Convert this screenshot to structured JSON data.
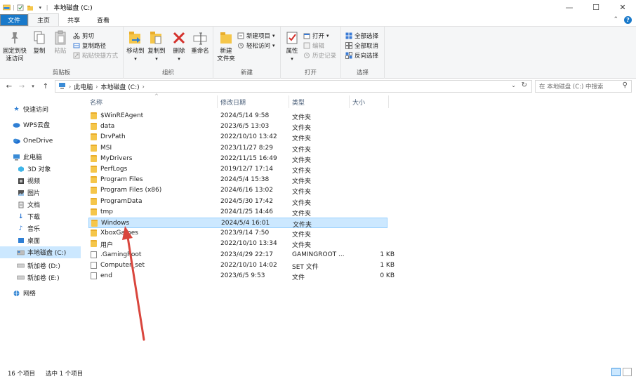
{
  "window": {
    "title": "本地磁盘 (C:)"
  },
  "tabs": {
    "file": "文件",
    "home": "主页",
    "share": "共享",
    "view": "查看"
  },
  "ribbon": {
    "clipboard": {
      "label": "剪贴板",
      "pin": "固定到快速访问",
      "pin_l1": "固定到快",
      "pin_l2": "速访问",
      "copy": "复制",
      "paste": "粘贴",
      "cut": "剪切",
      "copy_path": "复制路径",
      "paste_shortcut": "粘贴快捷方式"
    },
    "organize": {
      "label": "组织",
      "move_to": "移动到",
      "copy_to": "复制到",
      "delete": "删除",
      "rename": "重命名"
    },
    "new": {
      "label": "新建",
      "new_folder_l1": "新建",
      "new_folder_l2": "文件夹",
      "new_item": "新建项目",
      "easy_access": "轻松访问"
    },
    "open": {
      "label": "打开",
      "properties": "属性",
      "open": "打开",
      "edit": "编辑",
      "history": "历史记录"
    },
    "select": {
      "label": "选择",
      "select_all": "全部选择",
      "select_none": "全部取消",
      "invert": "反向选择"
    }
  },
  "address": {
    "crumb1": "此电脑",
    "crumb2": "本地磁盘 (C:)",
    "search_placeholder": "在 本地磁盘 (C:) 中搜索"
  },
  "nav": {
    "quick_access": "快速访问",
    "wps": "WPS云盘",
    "onedrive": "OneDrive",
    "this_pc": "此电脑",
    "objects3d": "3D 对象",
    "videos": "视频",
    "pictures": "图片",
    "documents": "文档",
    "downloads": "下载",
    "music": "音乐",
    "desktop": "桌面",
    "drive_c": "本地磁盘 (C:)",
    "drive_d": "新加卷 (D:)",
    "drive_e": "新加卷 (E:)",
    "network": "网络"
  },
  "columns": {
    "name": "名称",
    "modified": "修改日期",
    "type": "类型",
    "size": "大小"
  },
  "rows": [
    {
      "name": "$WinREAgent",
      "date": "2024/5/14 9:58",
      "type": "文件夹",
      "size": "",
      "kind": "folder"
    },
    {
      "name": "data",
      "date": "2023/6/5 13:03",
      "type": "文件夹",
      "size": "",
      "kind": "folder"
    },
    {
      "name": "DrvPath",
      "date": "2022/10/10 13:42",
      "type": "文件夹",
      "size": "",
      "kind": "folder"
    },
    {
      "name": "MSI",
      "date": "2023/11/27 8:29",
      "type": "文件夹",
      "size": "",
      "kind": "folder"
    },
    {
      "name": "MyDrivers",
      "date": "2022/11/15 16:49",
      "type": "文件夹",
      "size": "",
      "kind": "folder"
    },
    {
      "name": "PerfLogs",
      "date": "2019/12/7 17:14",
      "type": "文件夹",
      "size": "",
      "kind": "folder"
    },
    {
      "name": "Program Files",
      "date": "2024/5/4 15:38",
      "type": "文件夹",
      "size": "",
      "kind": "folder"
    },
    {
      "name": "Program Files (x86)",
      "date": "2024/6/16 13:02",
      "type": "文件夹",
      "size": "",
      "kind": "folder"
    },
    {
      "name": "ProgramData",
      "date": "2024/5/30 17:42",
      "type": "文件夹",
      "size": "",
      "kind": "folder"
    },
    {
      "name": "tmp",
      "date": "2024/1/25 14:46",
      "type": "文件夹",
      "size": "",
      "kind": "folder"
    },
    {
      "name": "Windows",
      "date": "2024/5/4 16:01",
      "type": "文件夹",
      "size": "",
      "kind": "folder",
      "selected": true
    },
    {
      "name": "XboxGames",
      "date": "2023/9/14 7:50",
      "type": "文件夹",
      "size": "",
      "kind": "folder"
    },
    {
      "name": "用户",
      "date": "2022/10/10 13:34",
      "type": "文件夹",
      "size": "",
      "kind": "folder"
    },
    {
      "name": ".GamingRoot",
      "date": "2023/4/29 22:17",
      "type": "GAMINGROOT ...",
      "size": "1 KB",
      "kind": "file"
    },
    {
      "name": "Computer_set",
      "date": "2022/10/10 14:02",
      "type": "SET 文件",
      "size": "1 KB",
      "kind": "file"
    },
    {
      "name": "end",
      "date": "2023/6/5 9:53",
      "type": "文件",
      "size": "0 KB",
      "kind": "file"
    }
  ],
  "status": {
    "count": "16 个项目",
    "selected": "选中 1 个项目"
  },
  "colors": {
    "accent": "#1979ca",
    "selection": "#cce8ff",
    "annotation_arrow": "#d9463d"
  }
}
